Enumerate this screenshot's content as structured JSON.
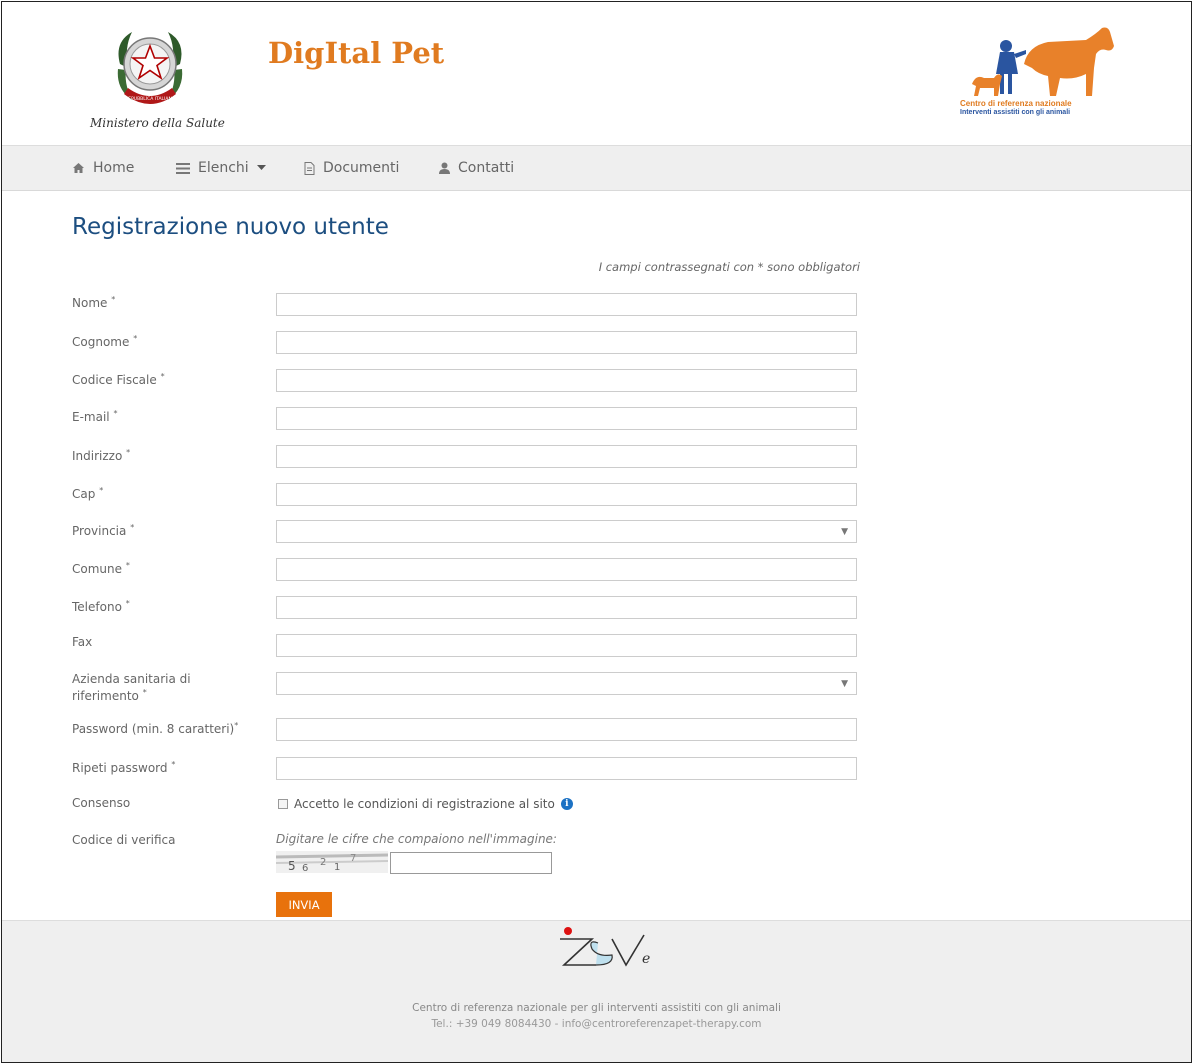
{
  "header": {
    "ministry_name": "Ministero della Salute",
    "emblem_text": "REPUBBLICA ITALIANA",
    "app_title": "DigItal Pet",
    "partner_line1": "Centro di referenza nazionale",
    "partner_line2": "Interventi assistiti con gli animali"
  },
  "nav": {
    "items": [
      {
        "label": "Home",
        "icon": "home-icon"
      },
      {
        "label": "Elenchi",
        "icon": "list-icon"
      },
      {
        "label": "Documenti",
        "icon": "document-icon"
      },
      {
        "label": "Contatti",
        "icon": "user-icon"
      }
    ]
  },
  "main": {
    "title": "Registrazione nuovo utente",
    "required_note": "I campi contrassegnati con * sono obbligatori",
    "fields": [
      {
        "label": "Nome",
        "required": true,
        "type": "text",
        "value": ""
      },
      {
        "label": "Cognome",
        "required": true,
        "type": "text",
        "value": ""
      },
      {
        "label": "Codice Fiscale",
        "required": true,
        "type": "text",
        "value": ""
      },
      {
        "label": "E-mail",
        "required": true,
        "type": "text",
        "value": ""
      },
      {
        "label": "Indirizzo",
        "required": true,
        "type": "text",
        "value": ""
      },
      {
        "label": "Cap",
        "required": true,
        "type": "text",
        "value": ""
      },
      {
        "label": "Provincia",
        "required": true,
        "type": "select",
        "value": ""
      },
      {
        "label": "Comune",
        "required": true,
        "type": "text",
        "value": ""
      },
      {
        "label": "Telefono",
        "required": true,
        "type": "text",
        "value": ""
      },
      {
        "label": "Fax",
        "required": false,
        "type": "text",
        "value": ""
      },
      {
        "label": "Azienda sanitaria di riferimento",
        "required": true,
        "type": "select",
        "value": ""
      },
      {
        "label": "Password (min. 8 caratteri)",
        "required": true,
        "type": "password",
        "value": ""
      },
      {
        "label": "Ripeti password",
        "required": true,
        "type": "password",
        "value": ""
      }
    ],
    "consent_label": "Consenso",
    "consent_text": "Accetto le condizioni di registrazione al sito",
    "consent_checked": false,
    "captcha_label": "Codice di verifica",
    "captcha_hint": "Digitare le cifre che compaiono nell'immagine:",
    "captcha_digits": [
      "5",
      "6",
      "2",
      "1",
      "7"
    ],
    "submit_label": "INVIA"
  },
  "footer": {
    "line1": "Centro di referenza nazionale per gli interventi assistiti con gli animali",
    "line2": "Tel.: +39 049 8084430 - info@centroreferenzapet-therapy.com"
  },
  "colors": {
    "accent": "#e8720c",
    "title_blue": "#1c4e80",
    "nav_bg": "#efefef"
  }
}
